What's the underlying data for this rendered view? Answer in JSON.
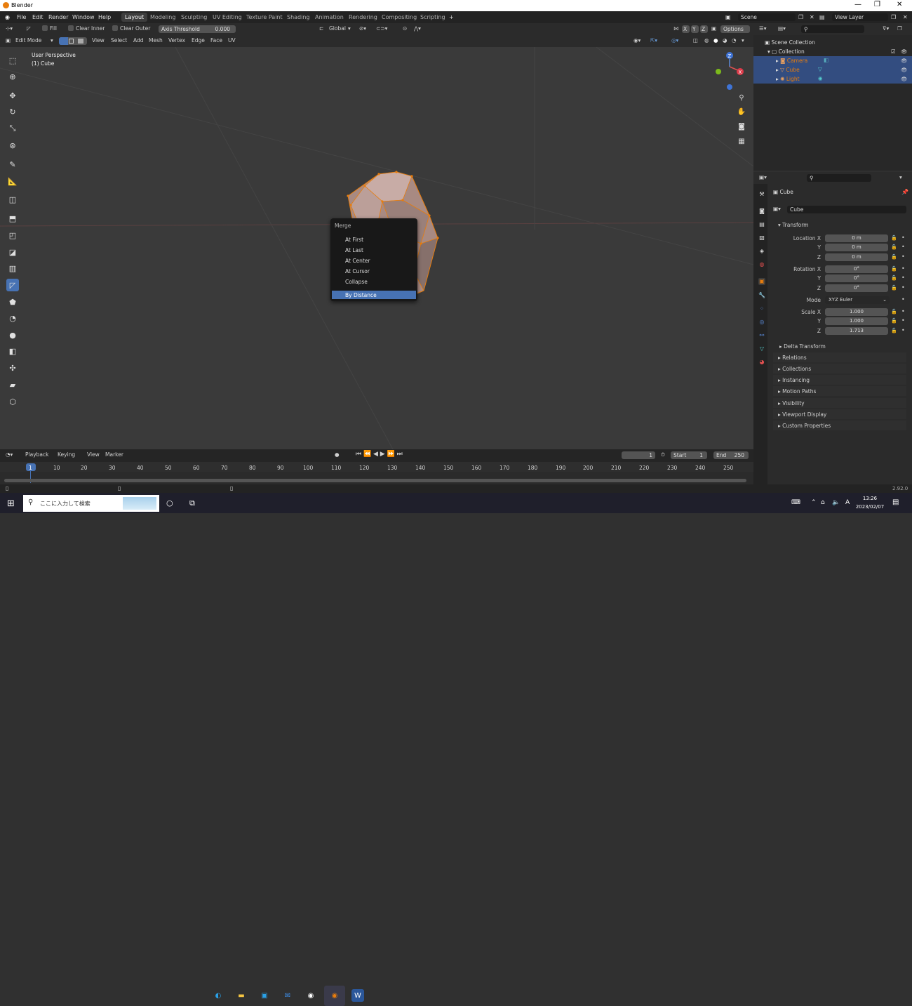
{
  "window": {
    "title": "Blender"
  },
  "menu": [
    "File",
    "Edit",
    "Render",
    "Window",
    "Help"
  ],
  "workspaces": [
    {
      "label": "Layout",
      "active": true
    },
    {
      "label": "Modeling"
    },
    {
      "label": "Sculpting"
    },
    {
      "label": "UV Editing"
    },
    {
      "label": "Texture Paint"
    },
    {
      "label": "Shading"
    },
    {
      "label": "Animation"
    },
    {
      "label": "Rendering"
    },
    {
      "label": "Compositing"
    },
    {
      "label": "Scripting"
    }
  ],
  "scene": {
    "name": "Scene",
    "view_layer": "View Layer"
  },
  "tool_header": {
    "fill": "Fill",
    "clear_inner": "Clear Inner",
    "clear_outer": "Clear Outer",
    "axis_threshold_label": "Axis Threshold",
    "axis_threshold_value": "0.000",
    "orientation": "Global",
    "options": "Options",
    "x": "X",
    "y": "Y",
    "z": "Z"
  },
  "view_header": {
    "mode": "Edit Mode",
    "menus": [
      "View",
      "Select",
      "Add",
      "Mesh",
      "Vertex",
      "Edge",
      "Face",
      "UV"
    ]
  },
  "viewport": {
    "perspective": "User Perspective",
    "object": "(1) Cube"
  },
  "merge_menu": {
    "title": "Merge",
    "items": [
      "At First",
      "At Last",
      "At Center",
      "At Cursor",
      "Collapse",
      "By Distance"
    ],
    "selected": "By Distance"
  },
  "outliner": {
    "scene_collection": "Scene Collection",
    "collection": "Collection",
    "items": [
      "Camera",
      "Cube",
      "Light"
    ]
  },
  "properties": {
    "object_name": "Cube",
    "data_name": "Cube",
    "transform": "Transform",
    "location_x_label": "Location X",
    "rotation_x_label": "Rotation X",
    "scale_x_label": "Scale X",
    "y_label": "Y",
    "z_label": "Z",
    "mode_label": "Mode",
    "mode_value": "XYZ Euler",
    "location": [
      "0 m",
      "0 m",
      "0 m"
    ],
    "rotation": [
      "0°",
      "0°",
      "0°"
    ],
    "scale": [
      "1.000",
      "1.000",
      "1.713"
    ],
    "delta_transform": "Delta Transform",
    "sections": [
      "Relations",
      "Collections",
      "Instancing",
      "Motion Paths",
      "Visibility",
      "Viewport Display",
      "Custom Properties"
    ]
  },
  "timeline": {
    "menus": [
      "Playback",
      "Keying",
      "View",
      "Marker"
    ],
    "current_frame": "1",
    "start_label": "Start",
    "start": "1",
    "end_label": "End",
    "end": "250",
    "ticks": [
      "1",
      "10",
      "20",
      "30",
      "40",
      "50",
      "60",
      "70",
      "80",
      "90",
      "100",
      "110",
      "120",
      "130",
      "140",
      "150",
      "160",
      "170",
      "180",
      "190",
      "200",
      "210",
      "220",
      "230",
      "240",
      "250"
    ]
  },
  "status": {
    "version": "2.92.0"
  },
  "taskbar": {
    "search_placeholder": "ここに入力して検索",
    "time": "13:26",
    "date": "2023/02/07"
  },
  "colors": {
    "accent": "#4772b3",
    "selection": "#e87d0d",
    "outliner_sel": "#334d80"
  }
}
